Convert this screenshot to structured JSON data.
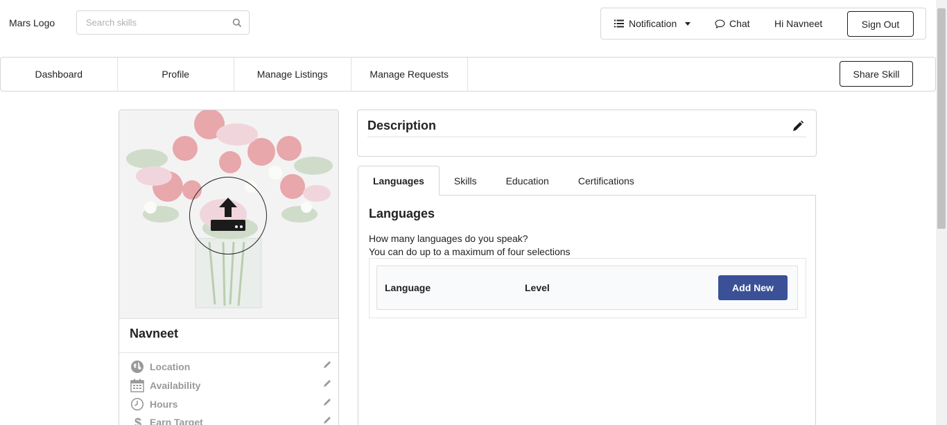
{
  "header": {
    "logo": "Mars Logo",
    "search_placeholder": "Search skills",
    "notification": "Notification",
    "chat": "Chat",
    "greeting": "Hi Navneet",
    "sign_out": "Sign Out"
  },
  "nav": {
    "items": [
      {
        "label": "Dashboard"
      },
      {
        "label": "Profile"
      },
      {
        "label": "Manage Listings"
      },
      {
        "label": "Manage Requests"
      }
    ],
    "share_skill": "Share Skill"
  },
  "profile": {
    "name": "Navneet",
    "details": [
      {
        "label": "Location",
        "icon": "globe-icon"
      },
      {
        "label": "Availability",
        "icon": "calendar-icon"
      },
      {
        "label": "Hours",
        "icon": "clock-icon"
      },
      {
        "label": "Earn Target",
        "icon": "dollar-icon"
      }
    ]
  },
  "description": {
    "title": "Description"
  },
  "tabs": [
    {
      "label": "Languages",
      "active": true
    },
    {
      "label": "Skills"
    },
    {
      "label": "Education"
    },
    {
      "label": "Certifications"
    }
  ],
  "languages": {
    "title": "Languages",
    "line1": "How many languages do you speak?",
    "line2": "You can do up to a maximum of four selections",
    "col_language": "Language",
    "col_level": "Level",
    "add_new": "Add New"
  },
  "colors": {
    "primary_button": "#3a5197",
    "border": "#d4d4d5"
  }
}
